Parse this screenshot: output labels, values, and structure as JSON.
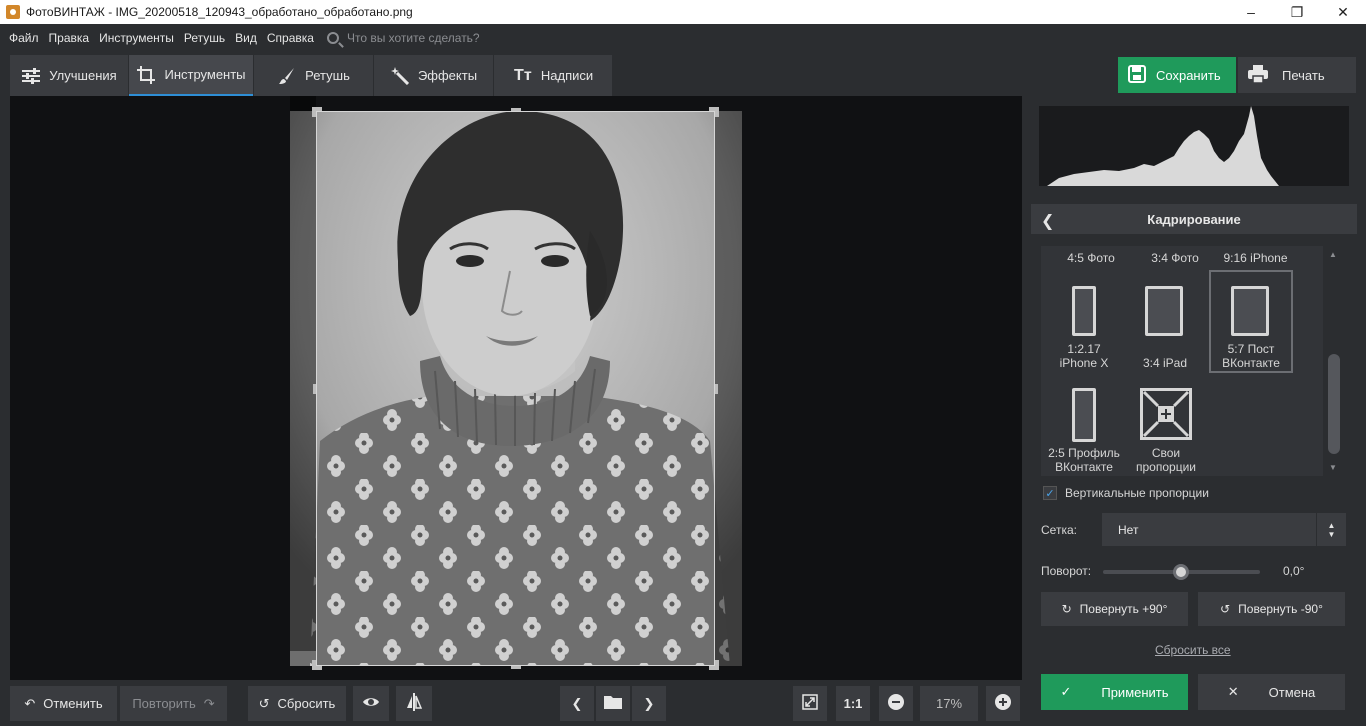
{
  "window": {
    "title": "ФотоВИНТАЖ - IMG_20200518_120943_обработано_обработано.png",
    "controls": [
      "–",
      "❐",
      "✕"
    ]
  },
  "menu": {
    "items": [
      "Файл",
      "Правка",
      "Инструменты",
      "Ретушь",
      "Вид",
      "Справка"
    ],
    "search_placeholder": "Что вы хотите сделать?"
  },
  "tabs": [
    {
      "label": "Улучшения",
      "icon": "sliders-icon",
      "active": false
    },
    {
      "label": "Инструменты",
      "icon": "crop-icon",
      "active": true
    },
    {
      "label": "Ретушь",
      "icon": "brush-icon",
      "active": false
    },
    {
      "label": "Эффекты",
      "icon": "magic-wand-icon",
      "active": false
    },
    {
      "label": "Надписи",
      "icon": "text-icon",
      "active": false
    }
  ],
  "actions": {
    "save": "Сохранить",
    "print": "Печать"
  },
  "bottom": {
    "undo": "Отменить",
    "redo": "Повторить",
    "reset": "Сбросить",
    "zoom_1_1": "1:1",
    "zoom": "17%"
  },
  "panel": {
    "title": "Кадрирование",
    "presets_row0": [
      "4:5 Фото",
      "3:4 Фото",
      "9:16 iPhone"
    ],
    "presets": [
      {
        "line1": "1:2.17",
        "line2": "iPhone X"
      },
      {
        "line1": "3:4 iPad",
        "line2": ""
      },
      {
        "line1": "5:7 Пост",
        "line2": "ВКонтакте",
        "selected": true
      },
      {
        "line1": "2:5 Профиль",
        "line2": "ВКонтакте"
      },
      {
        "line1": "Свои",
        "line2": "пропорции"
      }
    ],
    "vertical_label": "Вертикальные пропорции",
    "vertical_checked": true,
    "grid_label": "Сетка:",
    "grid_value": "Нет",
    "rotation_label": "Поворот:",
    "rotation_value": "0,0°",
    "rotate_plus": "Повернуть +90°",
    "rotate_minus": "Повернуть -90°",
    "reset_all": "Сбросить все",
    "apply": "Применить",
    "cancel": "Отмена"
  },
  "colors": {
    "accent_green": "#1f9a5b",
    "accent_blue": "#2f8fd6",
    "panel_bg": "#2b2d30"
  }
}
